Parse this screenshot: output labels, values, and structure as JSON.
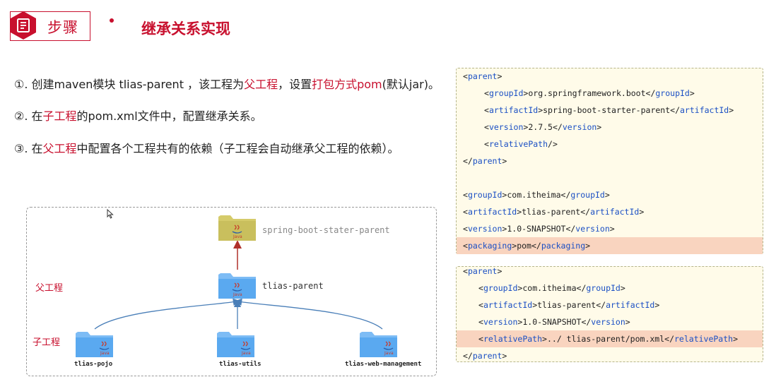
{
  "header": {
    "label": "步骤",
    "title": "继承关系实现"
  },
  "steps": [
    {
      "parts": [
        "①. 创建maven模块 tlias-parent ，该工程为",
        "父工程",
        "，设置",
        "打包方式pom",
        "(默认jar)。"
      ]
    },
    {
      "parts": [
        "②. 在",
        "子工程",
        "的pom.xml文件中，配置继承关系。"
      ]
    },
    {
      "parts": [
        "③. 在",
        "父工程",
        "中配置各个工程共有的依赖（子工程会自动继承父工程的依赖）。"
      ]
    }
  ],
  "diagram": {
    "top_node": "spring-boot-stater-parent",
    "mid_node": "tlias-parent",
    "parent_label": "父工程",
    "child_label": "子工程",
    "children": [
      "tlias-pojo",
      "tlias-utils",
      "tlias-web-management"
    ],
    "folder_badge": "Java"
  },
  "code_parent": [
    {
      "indent": 0,
      "open": "parent",
      "text": "",
      "close": "",
      "hl": false
    },
    {
      "indent": 1,
      "open": "groupId",
      "text": "org.springframework.boot",
      "close": "groupId",
      "hl": false
    },
    {
      "indent": 1,
      "open": "artifactId",
      "text": "spring-boot-starter-parent",
      "close": "artifactId",
      "hl": false
    },
    {
      "indent": 1,
      "open": "version",
      "text": "2.7.5",
      "close": "version",
      "hl": false
    },
    {
      "indent": 1,
      "selfclose": "relativePath",
      "hl": false
    },
    {
      "indent": 0,
      "closeonly": "parent",
      "hl": false
    },
    {
      "blank": true
    },
    {
      "indent": 0,
      "open": "groupId",
      "text": "com.itheima",
      "close": "groupId",
      "hl": false
    },
    {
      "indent": 0,
      "open": "artifactId",
      "text": "tlias-parent",
      "close": "artifactId",
      "hl": false
    },
    {
      "indent": 0,
      "open": "version",
      "text": "1.0-SNAPSHOT",
      "close": "version",
      "hl": false
    },
    {
      "indent": 0,
      "open": "packaging",
      "text": "pom",
      "close": "packaging",
      "hl": true
    }
  ],
  "code_child": [
    {
      "indent": 0,
      "open": "parent",
      "text": "",
      "close": "",
      "hl": false
    },
    {
      "indent": 1,
      "open": "groupId",
      "text": "com.itheima",
      "close": "groupId",
      "hl": false
    },
    {
      "indent": 1,
      "open": "artifactId",
      "text": "tlias-parent",
      "close": "artifactId",
      "hl": false
    },
    {
      "indent": 1,
      "open": "version",
      "text": "1.0-SNAPSHOT",
      "close": "version",
      "hl": false
    },
    {
      "indent": 1,
      "open": "relativePath",
      "text": "../ tlias-parent/pom.xml",
      "close": "relativePath",
      "hl": true
    },
    {
      "indent": 0,
      "closeonly": "parent",
      "hl": false
    }
  ],
  "colors": {
    "accent": "#c8102e",
    "tag": "#1a4fc4",
    "highlight": "#f9d4bf",
    "code_bg": "#fffbe9",
    "folder": "#5aa9f0",
    "folder_top": "#c9bf5d"
  }
}
